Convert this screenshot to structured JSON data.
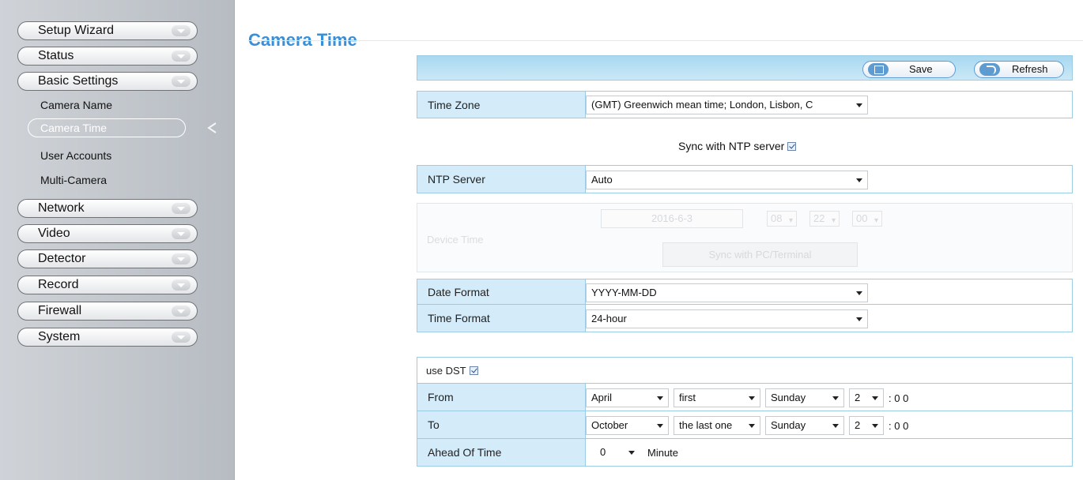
{
  "sidebar": {
    "menu": [
      {
        "label": "Setup Wizard"
      },
      {
        "label": "Status"
      },
      {
        "label": "Basic Settings"
      },
      {
        "label": "Network"
      },
      {
        "label": "Video"
      },
      {
        "label": "Detector"
      },
      {
        "label": "Record"
      },
      {
        "label": "Firewall"
      },
      {
        "label": "System"
      }
    ],
    "basic_sub": [
      {
        "label": "Camera Name"
      },
      {
        "label": "Camera Time"
      },
      {
        "label": "User Accounts"
      },
      {
        "label": "Multi-Camera"
      }
    ]
  },
  "page": {
    "title": "Camera Time"
  },
  "toolbar": {
    "save_label": "Save",
    "refresh_label": "Refresh"
  },
  "time_zone": {
    "label": "Time Zone",
    "value": "(GMT) Greenwich mean time; London, Lisbon, C"
  },
  "ntp_sync": {
    "label": "Sync with NTP server",
    "checked": true
  },
  "ntp_server": {
    "label": "NTP Server",
    "value": "Auto"
  },
  "device_time": {
    "label": "Device Time",
    "date": "2016-6-3",
    "hour": "08",
    "minute": "22",
    "second": "00",
    "sync_label": "Sync with PC/Terminal"
  },
  "date_format": {
    "label": "Date Format",
    "value": "YYYY-MM-DD"
  },
  "time_format": {
    "label": "Time Format",
    "value": "24-hour"
  },
  "dst": {
    "label": "use DST",
    "checked": true
  },
  "from": {
    "label": "From",
    "month": "April",
    "week": "first",
    "day": "Sunday",
    "hour": "2",
    "suffix": ": 0 0"
  },
  "to": {
    "label": "To",
    "month": "October",
    "week": "the last one",
    "day": "Sunday",
    "hour": "2",
    "suffix": ": 0 0"
  },
  "ahead": {
    "label": "Ahead Of Time",
    "value": "0",
    "unit": "Minute"
  },
  "colors": {
    "accent": "#3a8fd6",
    "label_bg": "#d4ecf9",
    "toolbar_bg": "#b4ddf3",
    "sidebar_bg": "#c3c7cc"
  }
}
